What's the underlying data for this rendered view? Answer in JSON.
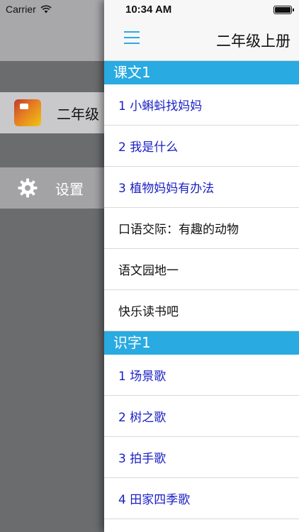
{
  "status": {
    "carrier": "Carrier",
    "time": "10:34 AM"
  },
  "drawer": {
    "book_label": "二年级",
    "settings_label": "设置"
  },
  "nav": {
    "title": "二年级上册"
  },
  "sections": [
    {
      "title": "课文1",
      "items": [
        {
          "label": "1 小蝌蚪找妈妈",
          "lesson": true
        },
        {
          "label": "2 我是什么",
          "lesson": true
        },
        {
          "label": "3 植物妈妈有办法",
          "lesson": true
        },
        {
          "label": "口语交际：有趣的动物",
          "lesson": false
        },
        {
          "label": "语文园地一",
          "lesson": false
        },
        {
          "label": "快乐读书吧",
          "lesson": false
        }
      ]
    },
    {
      "title": "识字1",
      "items": [
        {
          "label": "1 场景歌",
          "lesson": true
        },
        {
          "label": "2 树之歌",
          "lesson": true
        },
        {
          "label": "3 拍手歌",
          "lesson": true
        },
        {
          "label": "4 田家四季歌",
          "lesson": true
        }
      ]
    }
  ],
  "colors": {
    "accent": "#29aae1",
    "lesson_text": "#1a1fc4"
  },
  "icons": {
    "menu": "hamburger-icon",
    "settings": "gear-icon",
    "wifi": "wifi-icon",
    "battery": "battery-icon"
  }
}
